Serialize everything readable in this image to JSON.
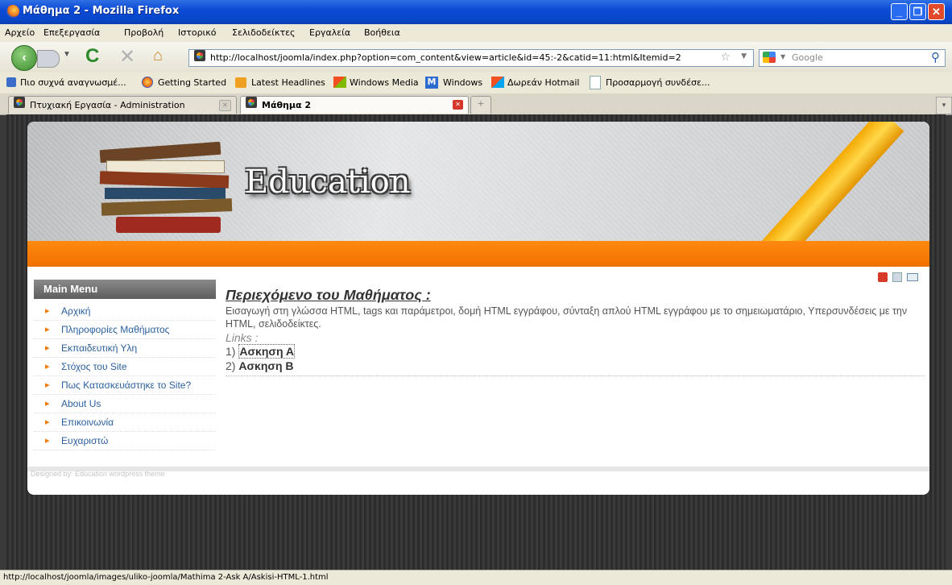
{
  "window": {
    "title": "Μάθημα 2 - Mozilla Firefox"
  },
  "menubar": [
    "Αρχείο",
    "Επεξεργασία",
    "Προβολή",
    "Ιστορικό",
    "Σελιδοδείκτες",
    "Εργαλεία",
    "Βοήθεια"
  ],
  "navbar": {
    "url": "http://localhost/joomla/index.php?option=com_content&view=article&id=45:-2&catid=11:html&Itemid=2",
    "search_placeholder": "Google"
  },
  "bookmarks": [
    "Πιο συχνά αναγνωσμέ...",
    "Getting Started",
    "Latest Headlines",
    "Windows Media",
    "Windows",
    "Δωρεάν Hotmail",
    "Προσαρμογή συνδέσε..."
  ],
  "tabs": [
    {
      "label": "Πτυχιακή Εργασία - Administration",
      "active": false
    },
    {
      "label": "Μάθημα 2",
      "active": true
    }
  ],
  "header": {
    "logo_text": "Education"
  },
  "sidebar": {
    "title": "Main Menu",
    "items": [
      {
        "label": "Αρχική"
      },
      {
        "label": "Πληροφορίες Μαθήματος"
      },
      {
        "label": "Εκπαιδευτική Υλη"
      },
      {
        "label": "Στόχος του Site"
      },
      {
        "label": "Πως Κατασκευάστηκε το Site?"
      },
      {
        "label": "About Us"
      },
      {
        "label": "Επικοινωνία"
      },
      {
        "label": "Ευχαριστώ"
      }
    ]
  },
  "article": {
    "title": "Περιεχόμενο του Μαθήματος :",
    "body": "Εισαγωγή στη γλώσσα HTML, tags και παράμετροι, δομή HTML εγγράφου, σύνταξη απλού HTML εγγράφου με το σημειωματάριο, Υπερσυνδέσεις με την HTML, σελιδοδείκτες.",
    "links_label": "Links :",
    "links": [
      {
        "num": "1)",
        "label": "Ασκηση Α"
      },
      {
        "num": "2)",
        "label": "Ασκηση Β"
      }
    ]
  },
  "footer": {
    "text": "Designed by: Education wordpress theme"
  },
  "statusbar": {
    "text": "http://localhost/joomla/images/uliko-joomla/Mathima 2-Ask A/Askisi-HTML-1.html"
  },
  "colors": {
    "accent_orange": "#f07800",
    "link_blue": "#2a5f9e",
    "titlebar_blue": "#0a4ad6"
  }
}
